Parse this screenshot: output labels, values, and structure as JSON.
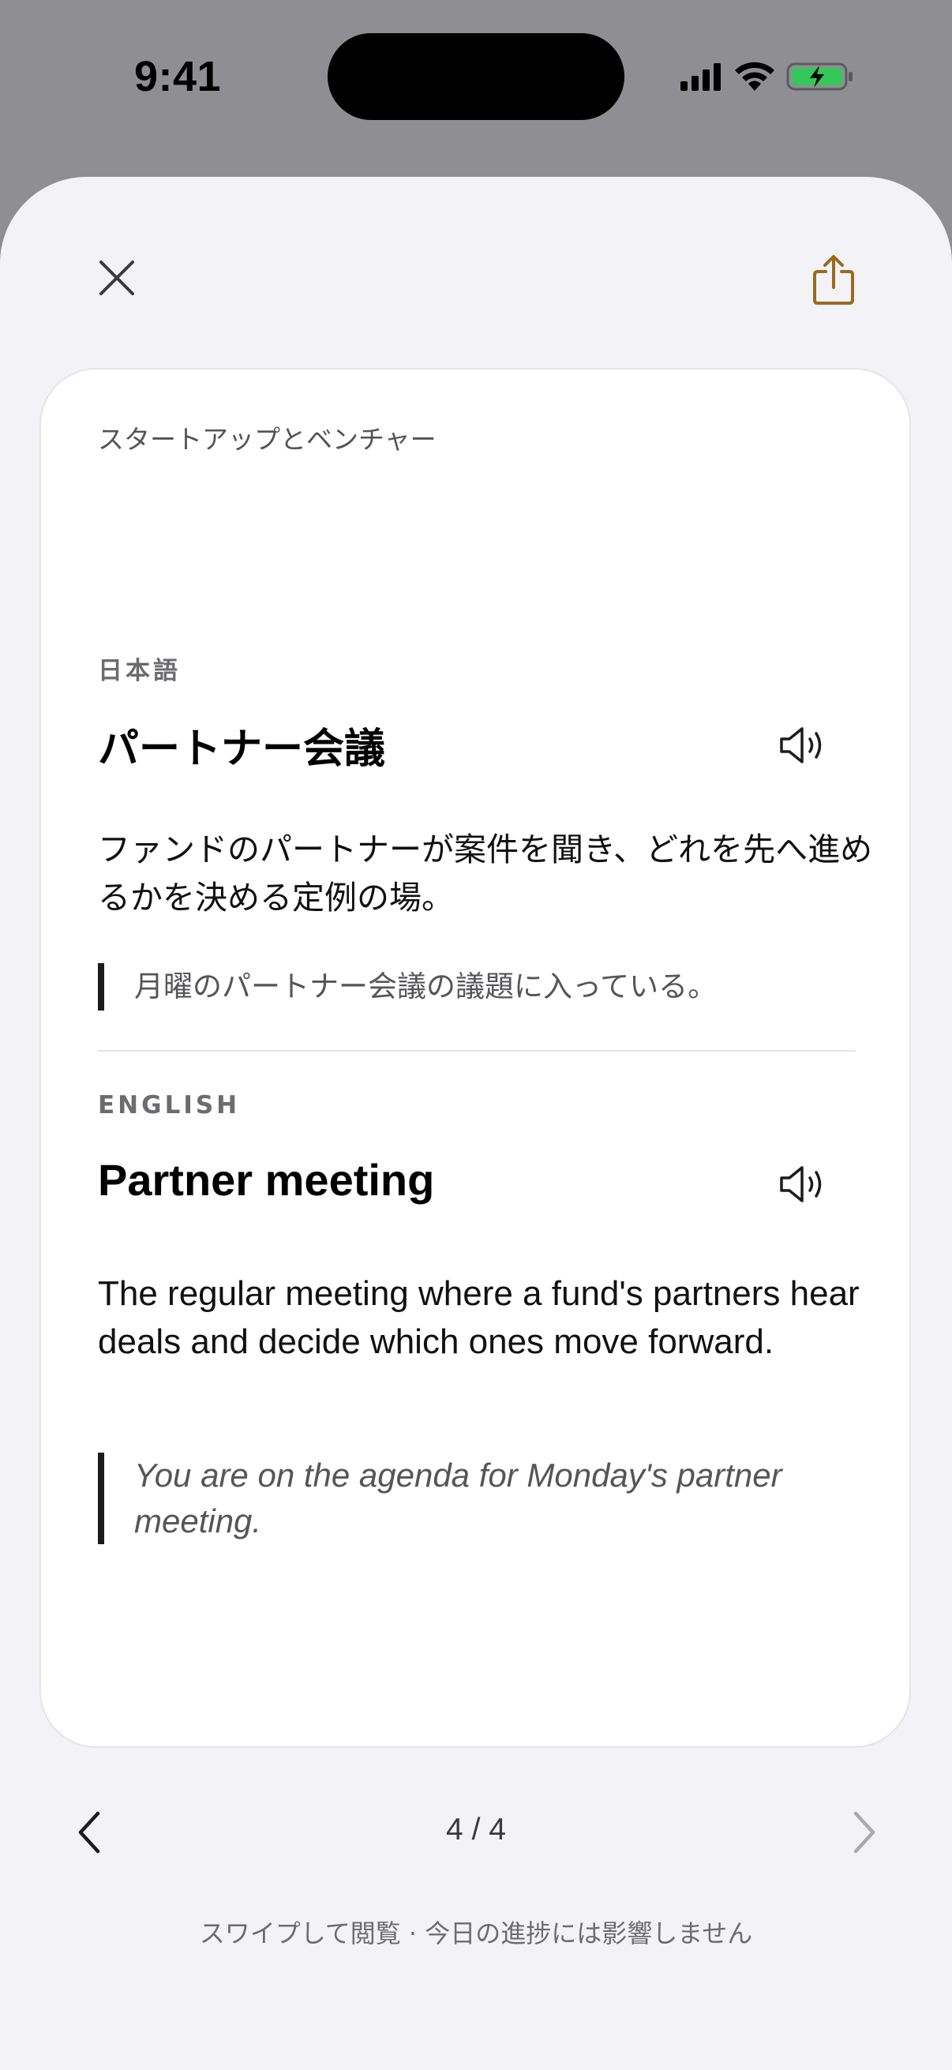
{
  "status_bar": {
    "time": "9:41"
  },
  "header": {
    "close_icon": "close-icon",
    "share_icon": "share-icon",
    "accent_color": "#9a6a1e"
  },
  "card": {
    "category": "スタートアップとベンチャー",
    "japanese": {
      "label": "日本語",
      "term": "パートナー会議",
      "definition": "ファンドのパートナーが案件を聞き、どれを先へ進めるかを決める定例の場。",
      "example": "月曜のパートナー会議の議題に入っている。"
    },
    "english": {
      "label": "ENGLISH",
      "term": "Partner meeting",
      "definition": "The regular meeting where a fund's partners hear deals and decide which ones move forward.",
      "example": "You are on the agenda for Monday's partner meeting."
    }
  },
  "navigation": {
    "page_indicator": "4 / 4",
    "hint": "スワイプして閲覧 · 今日の進捗には影響しません"
  }
}
